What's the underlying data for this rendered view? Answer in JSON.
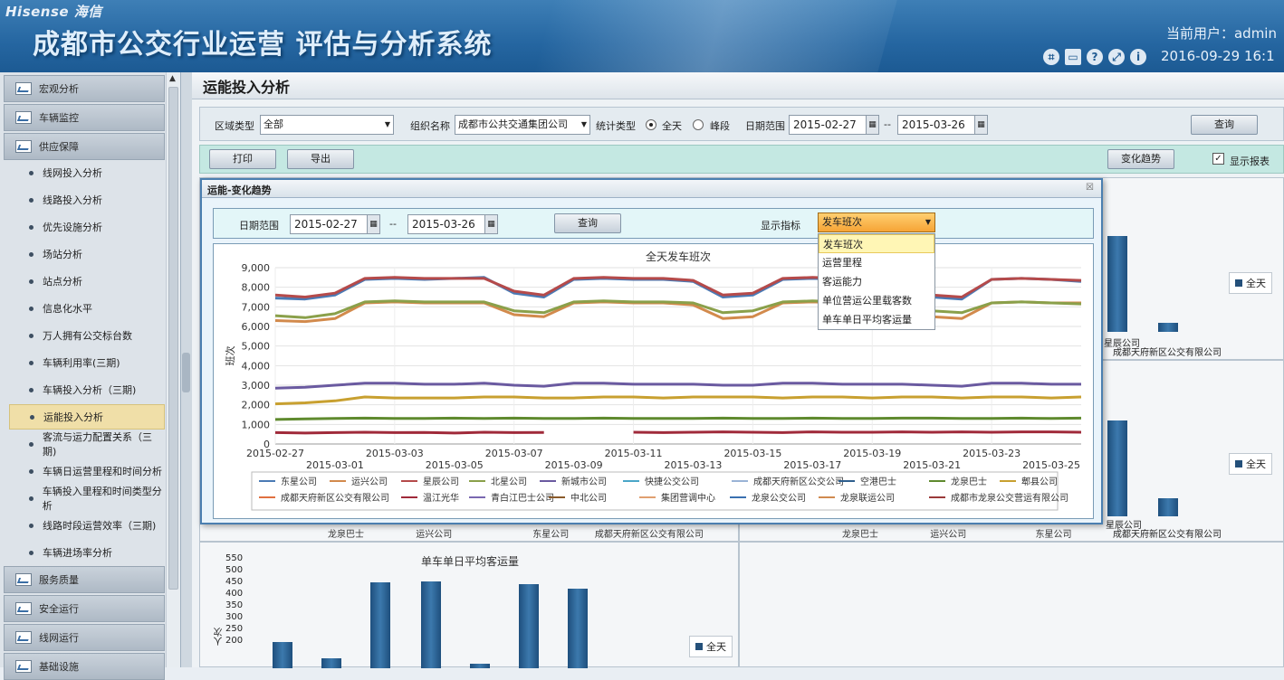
{
  "header": {
    "logo": "Hisense 海信",
    "title": "成都市公交行业运营 评估与分析系统",
    "user": "当前用户：admin",
    "datetime": "2016-09-29 16:1",
    "tool_icons": [
      "crop-icon",
      "window-icon",
      "help-icon",
      "fullscreen-icon",
      "info-icon"
    ]
  },
  "sidebar": {
    "sections": [
      {
        "label": "宏观分析"
      },
      {
        "label": "车辆监控"
      },
      {
        "label": "供应保障"
      }
    ],
    "items": [
      {
        "label": "线网投入分析"
      },
      {
        "label": "线路投入分析"
      },
      {
        "label": "优先设施分析"
      },
      {
        "label": "场站分析"
      },
      {
        "label": "站点分析"
      },
      {
        "label": "信息化水平"
      },
      {
        "label": "万人拥有公交标台数"
      },
      {
        "label": "车辆利用率(三期)"
      },
      {
        "label": "车辆投入分析（三期)"
      },
      {
        "label": "运能投入分析"
      },
      {
        "label": "客流与运力配置关系（三期)"
      },
      {
        "label": "车辆日运营里程和时间分析"
      },
      {
        "label": "车辆投入里程和时间类型分析"
      },
      {
        "label": "线路时段运营效率（三期)"
      },
      {
        "label": "车辆进场率分析"
      }
    ],
    "bottom_sections": [
      {
        "label": "服务质量"
      },
      {
        "label": "安全运行"
      },
      {
        "label": "线网运行"
      },
      {
        "label": "基础设施"
      }
    ]
  },
  "page": {
    "title": "运能投入分析"
  },
  "filter": {
    "region_label": "区域类型",
    "region_value": "全部",
    "org_label": "组织名称",
    "org_value": "成都市公共交通集团公司",
    "stat_label": "统计类型",
    "opt_all": "全天",
    "opt_peak": "峰段",
    "date_label": "日期范围",
    "date_from": "2015-02-27",
    "date_sep": "--",
    "date_to": "2015-03-26",
    "query": "查询"
  },
  "toolbar": {
    "print": "打印",
    "export": "导出",
    "trend": "变化趋势",
    "show_report": "显示报表"
  },
  "background": {
    "legend": "全天",
    "company_a": "星辰公司",
    "company_b": "成都天府新区公交有限公司",
    "row2_labels": [
      "龙泉巴士",
      "运兴公司",
      "东星公司",
      "成都天府新区公交有限公司"
    ],
    "row2_labels_right": [
      "龙泉巴士",
      "运兴公司",
      "东星公司",
      "成都天府新区公交有限公司"
    ],
    "bottom_title": "单车单日平均客运量",
    "bottom_ylabel": "人次",
    "bottom_ticks": [
      "550",
      "500",
      "450",
      "400",
      "350",
      "300",
      "250",
      "200"
    ]
  },
  "dialog": {
    "title": "运能-变化趋势",
    "date_label": "日期范围",
    "date_from": "2015-02-27",
    "date_sep": "--",
    "date_to": "2015-03-26",
    "query": "查询",
    "indicator_label": "显示指标",
    "indicator_value": "发车班次",
    "options": [
      "发车班次",
      "运营里程",
      "客运能力",
      "单位营运公里载客数",
      "单车单日平均客运量"
    ]
  },
  "chart_data": {
    "type": "line",
    "title": "全天发车班次",
    "ylabel": "班次",
    "ylim": [
      0,
      9000
    ],
    "yticks": [
      "9,000",
      "8,000",
      "7,000",
      "6,000",
      "5,000",
      "4,000",
      "3,000",
      "2,000",
      "1,000",
      "0"
    ],
    "x": [
      "2015-02-27",
      "2015-02-28",
      "2015-03-01",
      "2015-03-02",
      "2015-03-03",
      "2015-03-04",
      "2015-03-05",
      "2015-03-06",
      "2015-03-07",
      "2015-03-08",
      "2015-03-09",
      "2015-03-10",
      "2015-03-11",
      "2015-03-12",
      "2015-03-13",
      "2015-03-14",
      "2015-03-15",
      "2015-03-16",
      "2015-03-17",
      "2015-03-18",
      "2015-03-19",
      "2015-03-20",
      "2015-03-21",
      "2015-03-22",
      "2015-03-23",
      "2015-03-24",
      "2015-03-25",
      "2015-03-26"
    ],
    "xticks_top": [
      "2015-02-27",
      "2015-03-03",
      "2015-03-07",
      "2015-03-11",
      "2015-03-15",
      "2015-03-19",
      "2015-03-23"
    ],
    "xticks_bottom": [
      "2015-03-01",
      "2015-03-05",
      "2015-03-09",
      "2015-03-13",
      "2015-03-17",
      "2015-03-21",
      "2015-03-25"
    ],
    "series": [
      {
        "name": "东星公司",
        "color": "#4a7ab5",
        "values": [
          7450,
          7400,
          7600,
          8400,
          8450,
          8400,
          8450,
          8500,
          7700,
          7500,
          8400,
          8450,
          8400,
          8400,
          8300,
          7500,
          7600,
          8400,
          8450,
          8400,
          8400,
          8350,
          7500,
          7400,
          8400,
          8450,
          8400,
          8300
        ]
      },
      {
        "name": "运兴公司",
        "color": "#d28a4c",
        "values": [
          6300,
          6250,
          6400,
          7200,
          7250,
          7200,
          7200,
          7200,
          6600,
          6500,
          7200,
          7250,
          7200,
          7200,
          7100,
          6400,
          6500,
          7200,
          7250,
          7200,
          7200,
          7150,
          6500,
          6400,
          7200,
          7250,
          7200,
          7200
        ]
      },
      {
        "name": "星辰公司",
        "color": "#b54a4a",
        "values": [
          7600,
          7500,
          7700,
          8450,
          8500,
          8450,
          8450,
          8450,
          7800,
          7600,
          8450,
          8500,
          8450,
          8450,
          8350,
          7600,
          7700,
          8450,
          8500,
          8450,
          8450,
          8400,
          7600,
          7500,
          8400,
          8450,
          8400,
          8350
        ]
      },
      {
        "name": "北星公司",
        "color": "#8aa04a",
        "values": [
          6550,
          6450,
          6650,
          7250,
          7300,
          7250,
          7250,
          7250,
          6800,
          6700,
          7250,
          7300,
          7250,
          7250,
          7200,
          6700,
          6800,
          7250,
          7300,
          7250,
          7250,
          7200,
          6800,
          6700,
          7200,
          7250,
          7200,
          7150
        ]
      },
      {
        "name": "新城市公司",
        "color": "#6a5aa0",
        "values": [
          2850,
          2900,
          3000,
          3100,
          3100,
          3050,
          3050,
          3100,
          3000,
          2950,
          3100,
          3100,
          3050,
          3050,
          3050,
          3000,
          3000,
          3100,
          3100,
          3050,
          3050,
          3050,
          3000,
          2950,
          3100,
          3100,
          3050,
          3050
        ]
      },
      {
        "name": "快捷公交公司",
        "color": "#4aa6c8",
        "values": [
          null,
          null,
          null,
          null,
          null,
          null,
          null,
          null,
          null,
          null,
          null,
          null,
          null,
          null,
          null,
          null,
          null,
          null,
          null,
          null,
          null,
          null,
          null,
          null,
          null,
          null,
          null,
          null
        ]
      },
      {
        "name": "成都天府新区公交公司",
        "color": "#9ab3d6",
        "values": [
          null,
          null,
          null,
          null,
          null,
          null,
          null,
          null,
          null,
          null,
          null,
          null,
          null,
          null,
          null,
          null,
          null,
          null,
          null,
          null,
          null,
          null,
          null,
          null,
          null,
          null,
          null,
          null
        ]
      },
      {
        "name": "空港巴士",
        "color": "#2e5f8e",
        "values": [
          null,
          null,
          null,
          null,
          null,
          null,
          null,
          null,
          null,
          null,
          null,
          null,
          null,
          null,
          null,
          null,
          null,
          null,
          null,
          null,
          null,
          null,
          null,
          null,
          null,
          null,
          null,
          null
        ]
      },
      {
        "name": "龙泉巴士",
        "color": "#5f8a2e",
        "values": [
          1250,
          1280,
          1300,
          1320,
          1300,
          1300,
          1320,
          1300,
          1320,
          1300,
          1300,
          1320,
          1300,
          1300,
          1300,
          1320,
          1300,
          1300,
          1320,
          1300,
          1300,
          1320,
          1320,
          1300,
          1300,
          1320,
          1300,
          1320
        ]
      },
      {
        "name": "郫县公司",
        "color": "#c8a030",
        "values": [
          2050,
          2100,
          2200,
          2400,
          2350,
          2350,
          2350,
          2400,
          2400,
          2350,
          2350,
          2400,
          2400,
          2350,
          2400,
          2400,
          2400,
          2350,
          2400,
          2400,
          2350,
          2400,
          2400,
          2350,
          2400,
          2400,
          2350,
          2400
        ]
      },
      {
        "name": "成都天府新区公交有限公司",
        "color": "#e07040",
        "values": [
          null,
          null,
          null,
          null,
          null,
          null,
          null,
          null,
          null,
          null,
          null,
          null,
          null,
          null,
          null,
          null,
          null,
          null,
          null,
          null,
          null,
          null,
          null,
          null,
          null,
          null,
          null,
          null
        ]
      },
      {
        "name": "温江光华",
        "color": "#a02a3a",
        "values": [
          580,
          560,
          580,
          600,
          580,
          590,
          560,
          600,
          580,
          590,
          null,
          null,
          600,
          580,
          600,
          620,
          600,
          580,
          620,
          600,
          600,
          620,
          600,
          620,
          600,
          620,
          620,
          600
        ]
      },
      {
        "name": "青白江巴士公司",
        "color": "#7a68b0",
        "values": [
          null,
          null,
          null,
          null,
          null,
          null,
          null,
          null,
          null,
          null,
          null,
          null,
          null,
          null,
          null,
          null,
          null,
          null,
          null,
          null,
          null,
          null,
          null,
          null,
          null,
          null,
          null,
          null
        ]
      },
      {
        "name": "中北公司",
        "color": "#8a5a2a",
        "values": [
          null,
          null,
          null,
          null,
          null,
          null,
          null,
          null,
          null,
          null,
          null,
          null,
          null,
          null,
          null,
          null,
          null,
          null,
          null,
          null,
          null,
          null,
          null,
          null,
          null,
          null,
          null,
          null
        ]
      },
      {
        "name": "集团营调中心",
        "color": "#e0a070",
        "values": [
          null,
          null,
          null,
          null,
          null,
          null,
          null,
          null,
          null,
          null,
          null,
          null,
          null,
          null,
          null,
          null,
          null,
          null,
          null,
          null,
          null,
          null,
          null,
          null,
          null,
          null,
          null,
          null
        ]
      },
      {
        "name": "龙泉公交公司",
        "color": "#3a70b0",
        "values": [
          null,
          null,
          null,
          null,
          null,
          null,
          null,
          null,
          null,
          null,
          null,
          null,
          null,
          null,
          null,
          null,
          null,
          null,
          null,
          null,
          null,
          null,
          null,
          null,
          null,
          null,
          null,
          null
        ]
      },
      {
        "name": "龙泉联运公司",
        "color": "#d08a50",
        "values": [
          null,
          null,
          null,
          null,
          null,
          null,
          null,
          null,
          null,
          null,
          null,
          null,
          null,
          null,
          null,
          null,
          null,
          null,
          null,
          null,
          null,
          null,
          null,
          null,
          null,
          null,
          null,
          null
        ]
      },
      {
        "name": "成都市龙泉公交营运有限公司",
        "color": "#9a3a3a",
        "values": [
          null,
          null,
          null,
          null,
          null,
          null,
          null,
          null,
          null,
          null,
          null,
          null,
          null,
          null,
          null,
          null,
          null,
          null,
          null,
          null,
          null,
          null,
          null,
          null,
          null,
          null,
          null,
          null
        ]
      }
    ],
    "legend_placement": "bottom",
    "grid": true
  }
}
